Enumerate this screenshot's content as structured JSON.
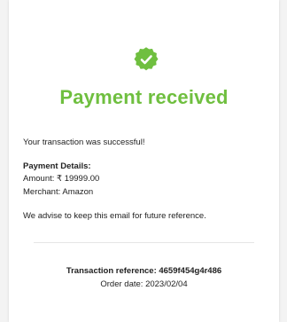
{
  "colors": {
    "accent": "#6fbf3f",
    "text": "#222222",
    "background": "#ffffff"
  },
  "icon": "verified-check-badge-icon",
  "title": "Payment received",
  "success_message": "Your transaction was successful!",
  "details": {
    "heading": "Payment Details:",
    "amount": "Amount: ₹ 19999.00",
    "merchant": "Merchant: Amazon"
  },
  "advice": "We advise to keep this email for future reference.",
  "footer": {
    "transaction_reference": "Transaction reference: 4659f454g4r486",
    "order_date": "Order date: 2023/02/04"
  }
}
